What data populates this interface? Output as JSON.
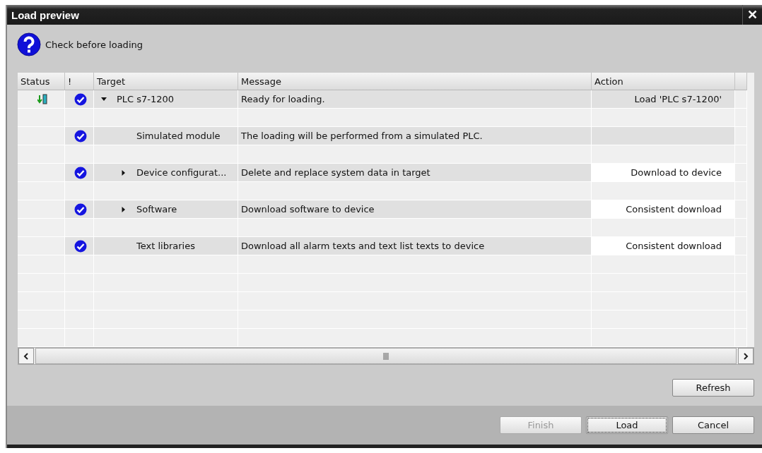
{
  "window": {
    "title": "Load preview",
    "close": "✕"
  },
  "prompt": "Check before loading",
  "table": {
    "columns": [
      "Status",
      "!",
      "Target",
      "Message",
      "Action"
    ],
    "rows": [
      {
        "load_pending": true,
        "ready": true,
        "target": "PLC s7-1200",
        "expanded": true,
        "message": "Ready for loading.",
        "action": "Load 'PLC s7-1200'",
        "action_editable": false,
        "children": [
          {
            "load_pending": false,
            "ready": true,
            "target": "Simulated module",
            "message": "The loading will be performed from a simulated PLC.",
            "action_editable": false
          },
          {
            "load_pending": false,
            "ready": true,
            "target": "Device configurat...",
            "expanded": false,
            "message": "Delete and replace system data in target",
            "action": "Download to device",
            "action_editable": true
          },
          {
            "load_pending": false,
            "ready": true,
            "target": "Software",
            "expanded": false,
            "message": "Download software to device",
            "action": "Consistent download",
            "action_editable": true
          },
          {
            "load_pending": false,
            "ready": true,
            "target": "Text libraries",
            "message": "Download all alarm texts and text list texts to device",
            "action": "Consistent download",
            "action_editable": true
          }
        ]
      }
    ]
  },
  "refresh_button": {
    "label": "Refresh"
  },
  "buttons": [
    {
      "label": "Finish",
      "disabled": true,
      "focused": false
    },
    {
      "label": "Load",
      "disabled": false,
      "focused": true
    },
    {
      "label": "Cancel",
      "disabled": false,
      "focused": false
    }
  ]
}
